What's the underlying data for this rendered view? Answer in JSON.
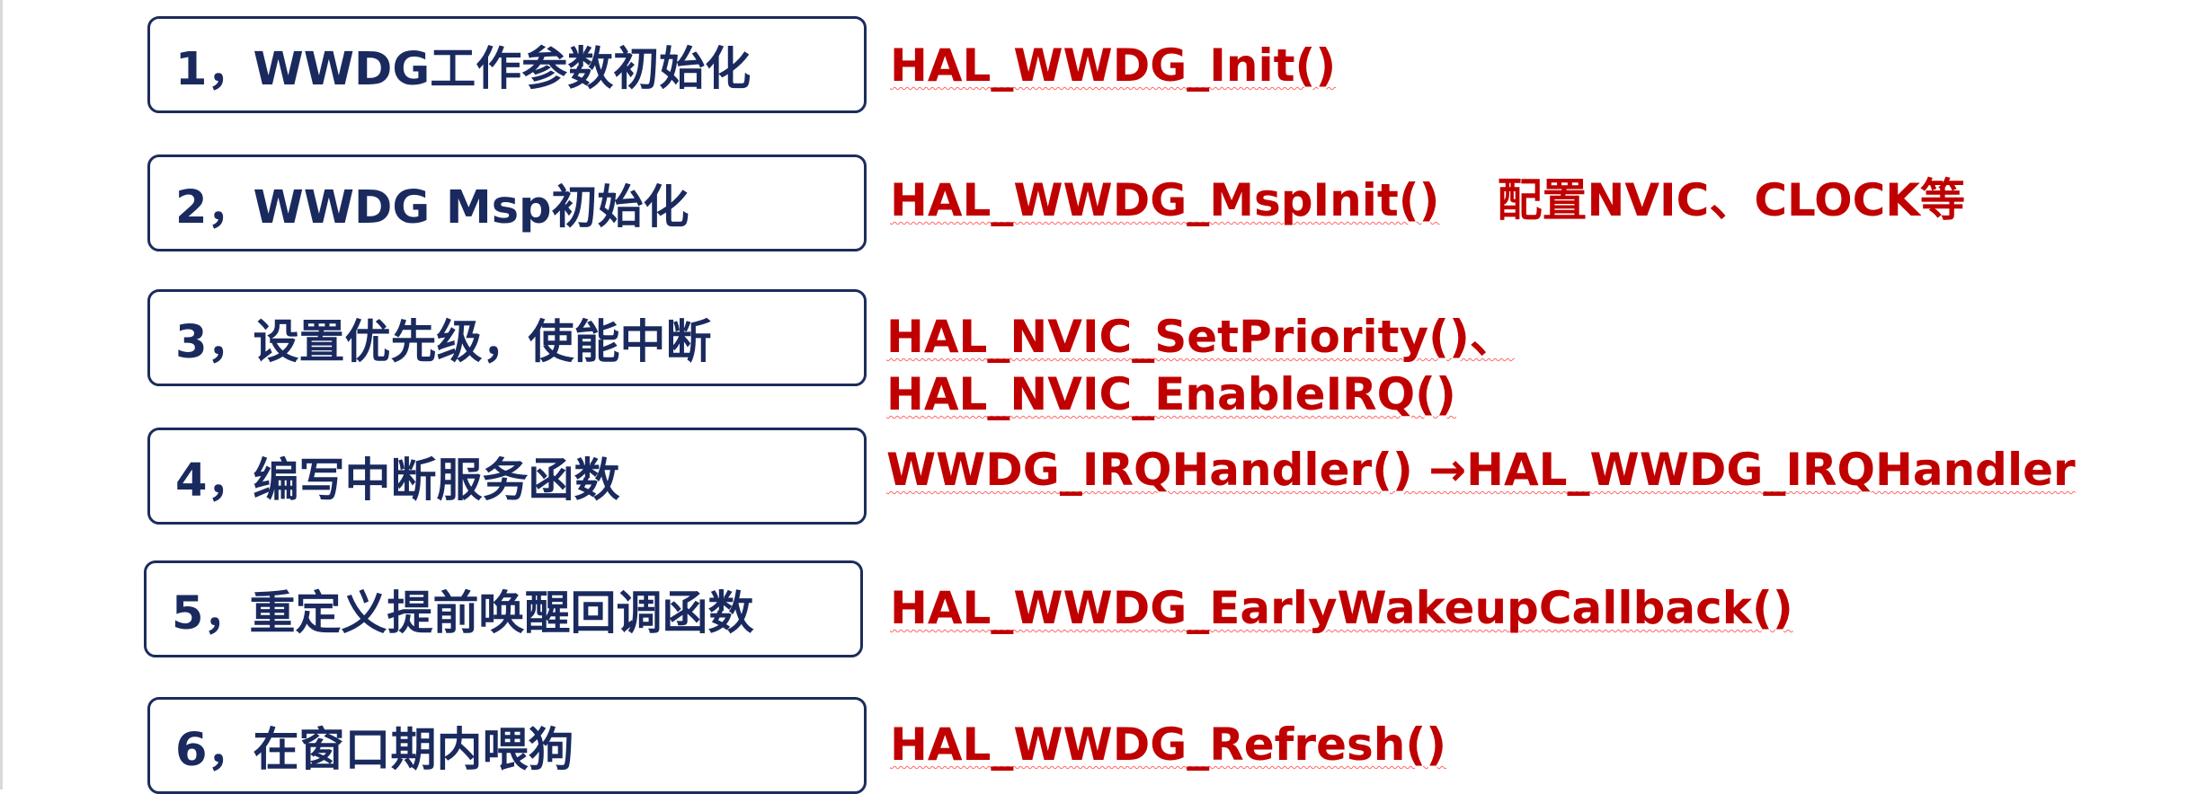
{
  "steps": [
    {
      "label": "1，WWDG工作参数初始化"
    },
    {
      "label": "2，WWDG Msp初始化"
    },
    {
      "label": "3，设置优先级，使能中断"
    },
    {
      "label": "4，编写中断服务函数"
    },
    {
      "label": "5，重定义提前唤醒回调函数"
    },
    {
      "label": "6，在窗口期内喂狗"
    }
  ],
  "functions": {
    "init": "HAL_WWDG_Init()",
    "msp_init": "HAL_WWDG_MspInit()",
    "msp_note": "配置NVIC、CLOCK等",
    "set_priority": "HAL_NVIC_SetPriority()、",
    "enable_irq": "HAL_NVIC_EnableIRQ()",
    "irq_handler": "WWDG_IRQHandler() →HAL_WWDG_IRQHandler",
    "early_wakeup": "HAL_WWDG_EarlyWakeupCallback()",
    "refresh": "HAL_WWDG_Refresh()"
  },
  "colors": {
    "box_border": "#1c2c5c",
    "step_text": "#1a2a5e",
    "function_text": "#c00000"
  }
}
